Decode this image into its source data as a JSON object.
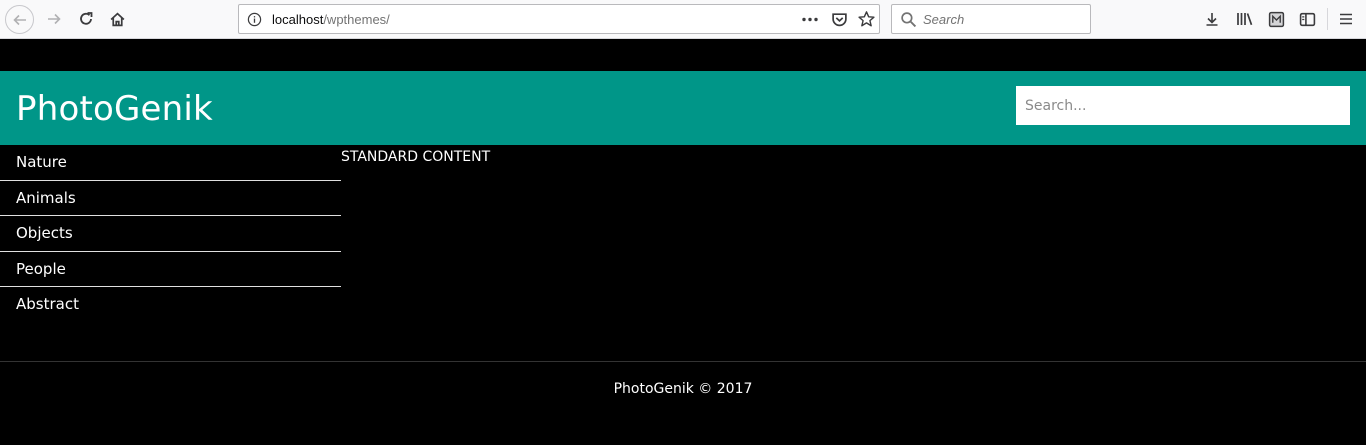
{
  "browser": {
    "url_host": "localhost",
    "url_path": "/wpthemes/",
    "search_placeholder": "Search",
    "icons": {
      "back": "arrow-left-icon",
      "forward": "arrow-right-icon",
      "reload": "reload-icon",
      "home": "home-icon",
      "info": "info-icon",
      "more": "more-horizontal-icon",
      "pocket": "pocket-icon",
      "bookmark": "star-icon",
      "search": "search-icon",
      "download": "download-icon",
      "library": "library-icon",
      "reader": "reader-icon",
      "sidebar": "sidebar-icon",
      "menu": "hamburger-icon"
    }
  },
  "site": {
    "title": "PhotoGenik",
    "search_placeholder": "Search...",
    "header_color": "#009688"
  },
  "nav": {
    "items": [
      {
        "label": "Nature"
      },
      {
        "label": "Animals"
      },
      {
        "label": "Objects"
      },
      {
        "label": "People"
      },
      {
        "label": "Abstract"
      }
    ]
  },
  "content": {
    "text": "STANDARD CONTENT"
  },
  "footer": {
    "text": "PhotoGenik © 2017"
  }
}
